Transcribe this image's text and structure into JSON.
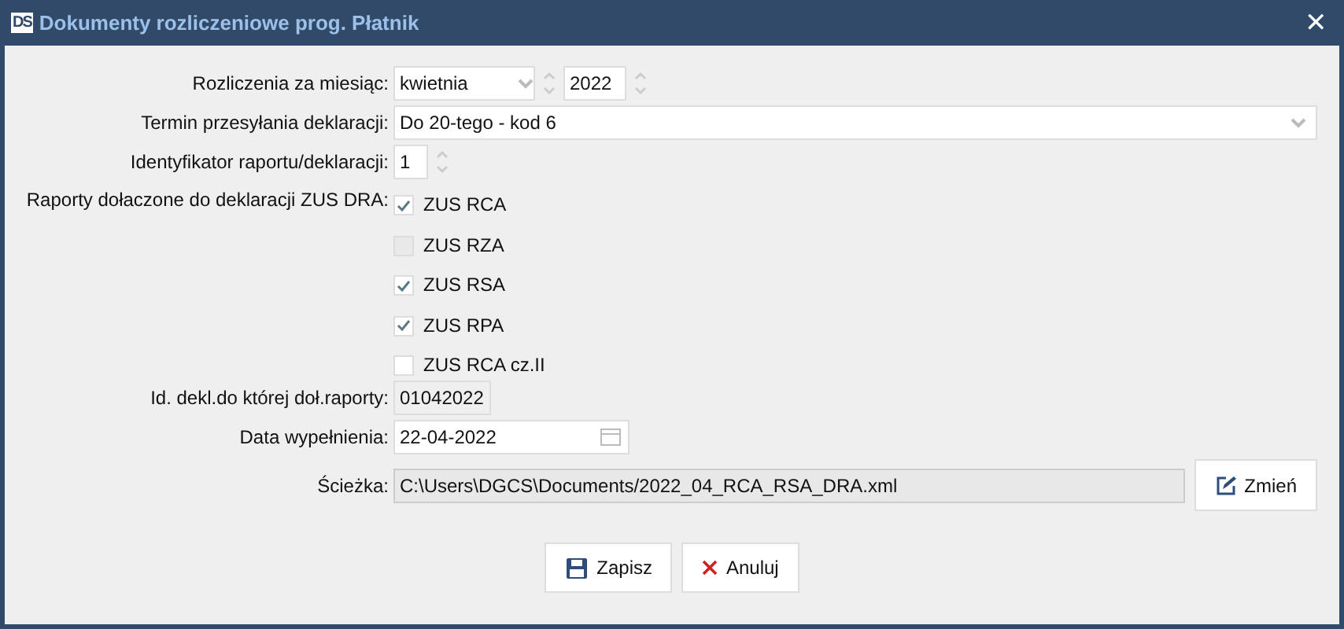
{
  "window": {
    "title": "Dokumenty rozliczeniowe prog. Płatnik",
    "logo": "DS",
    "close": "✕"
  },
  "month": {
    "label": "Rozliczenia za miesiąc:",
    "value": "kwietnia",
    "year": "2022"
  },
  "deadline": {
    "label": "Termin przesyłania deklaracji:",
    "value": "Do 20-tego - kod 6"
  },
  "identifier": {
    "label": "Identyfikator raportu/deklaracji:",
    "value": "1"
  },
  "reports": {
    "label": "Raporty dołaczone do deklaracji ZUS DRA:",
    "items": [
      {
        "label": "ZUS RCA",
        "checked": true,
        "disabled": false
      },
      {
        "label": "ZUS RZA",
        "checked": false,
        "disabled": true
      },
      {
        "label": "ZUS RSA",
        "checked": true,
        "disabled": false
      },
      {
        "label": "ZUS RPA",
        "checked": true,
        "disabled": false
      },
      {
        "label": "ZUS RCA cz.II",
        "checked": false,
        "disabled": false
      }
    ]
  },
  "declaration_id": {
    "label": "Id. dekl.do której doł.raporty:",
    "value": "01042022"
  },
  "fill_date": {
    "label": "Data wypełnienia:",
    "value": "22-04-2022"
  },
  "path": {
    "label": "Ścieżka:",
    "value": "C:\\Users\\DGCS\\Documents/2022_04_RCA_RSA_DRA.xml",
    "button": "Zmień"
  },
  "buttons": [
    {
      "kind": "save",
      "label": "Zapisz"
    },
    {
      "kind": "cancel",
      "label": "Anuluj"
    }
  ]
}
